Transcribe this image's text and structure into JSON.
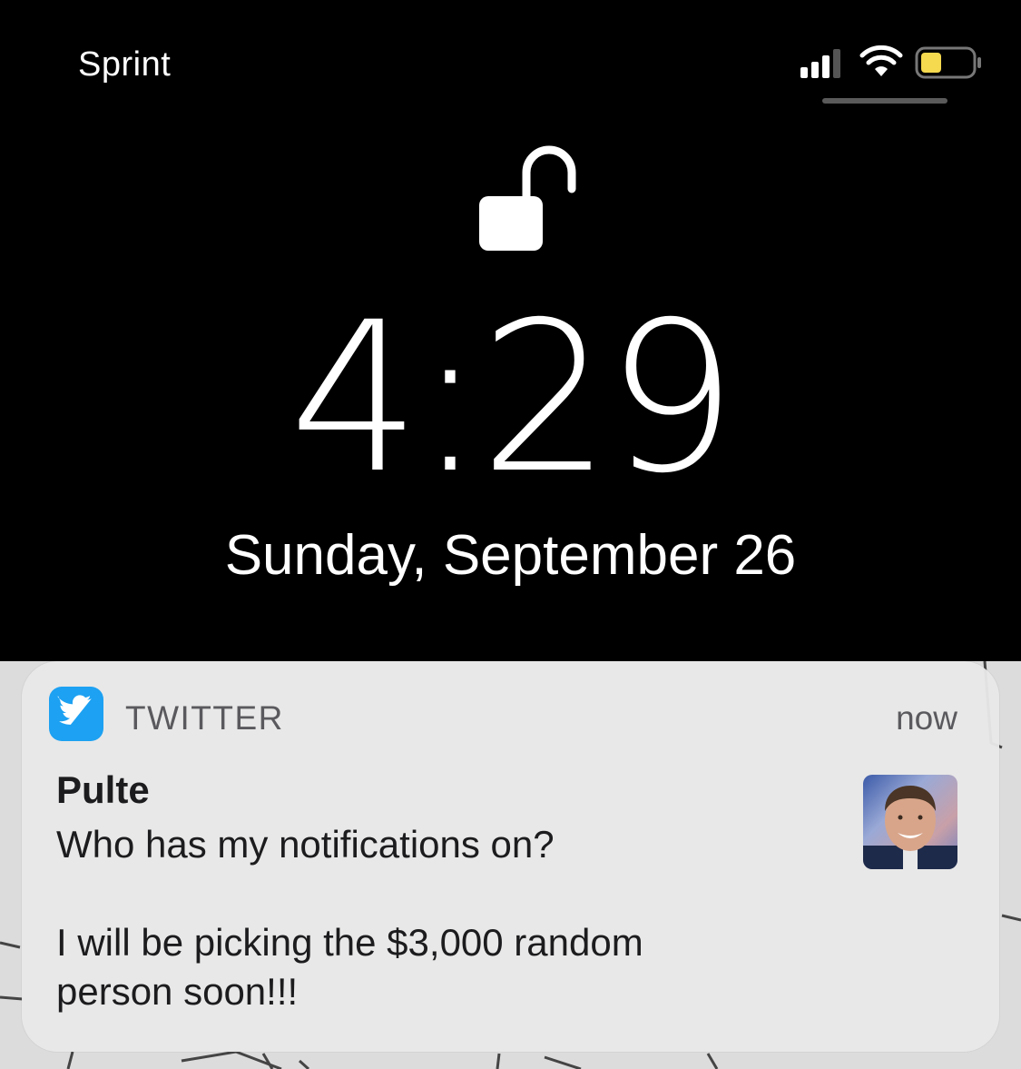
{
  "status_bar": {
    "carrier": "Sprint",
    "signal_icon": "cellular-signal-icon",
    "wifi_icon": "wifi-icon",
    "battery_icon": "battery-icon",
    "battery_color": "#f5d94e"
  },
  "lock_screen": {
    "lock_icon": "unlocked-padlock-icon",
    "time": "4:29",
    "date": "Sunday, September 26"
  },
  "notification": {
    "app_icon": "twitter-bird-icon",
    "app_name": "TWITTER",
    "time": "now",
    "sender": "Pulte",
    "message": "Who has my notifications on?\n\nI will be picking the $3,000 random\nperson soon!!!",
    "avatar": "sender-avatar",
    "accent_color": "#1da1f2"
  }
}
